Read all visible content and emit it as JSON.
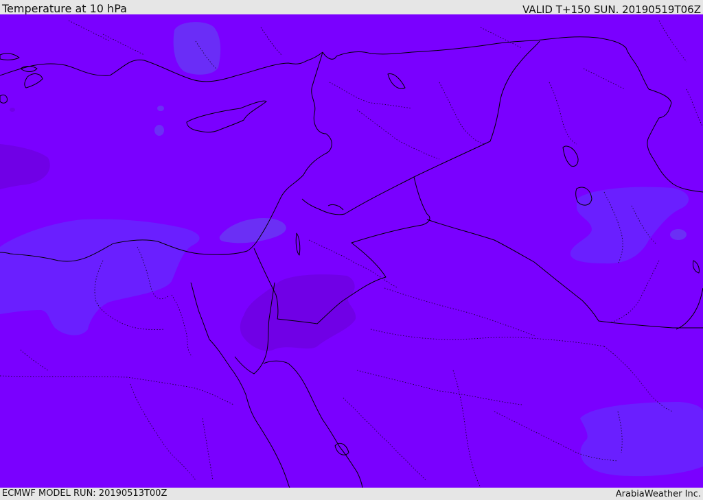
{
  "header": {
    "title": "Temperature at 10 hPa",
    "valid": "VALID T+150 SUN. 20190519T06Z"
  },
  "footer": {
    "model_run": "ECMWF MODEL RUN: 20190513T00Z",
    "credit": "ArabiaWeather Inc."
  },
  "map": {
    "colors": {
      "base": "#7a00ff",
      "warmer": "#7100e6",
      "cooler": "#6a1cff",
      "cool_light": "#6b2ff5",
      "border": "#000000"
    }
  }
}
